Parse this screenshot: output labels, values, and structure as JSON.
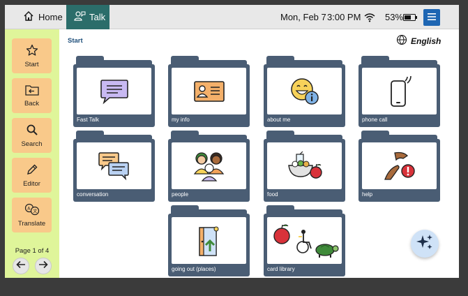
{
  "tabs": {
    "home": "Home",
    "talk": "Talk"
  },
  "status": {
    "date": "Mon, Feb 7",
    "time": "3:00 PM",
    "battery": "53%"
  },
  "sidebar": {
    "buttons": [
      {
        "label": "Start",
        "icon": "star-icon"
      },
      {
        "label": "Back",
        "icon": "back-folder-icon"
      },
      {
        "label": "Search",
        "icon": "search-icon"
      },
      {
        "label": "Editor",
        "icon": "pencil-icon"
      },
      {
        "label": "Translate",
        "icon": "translate-icon"
      }
    ],
    "page_indicator": "Page 1 of 4"
  },
  "breadcrumb": "Start",
  "language": "English",
  "folders": [
    {
      "label": "Fast Talk",
      "icon": "speech-bubble-icon"
    },
    {
      "label": "my info",
      "icon": "id-card-icon"
    },
    {
      "label": "about me",
      "icon": "smiley-info-icon"
    },
    {
      "label": "phone call",
      "icon": "phone-icon"
    },
    {
      "label": "conversation",
      "icon": "conversation-icon"
    },
    {
      "label": "people",
      "icon": "people-icon"
    },
    {
      "label": "food",
      "icon": "food-icon"
    },
    {
      "label": "help",
      "icon": "help-hands-icon"
    },
    {
      "label": "going out (places)",
      "icon": "door-exit-icon"
    },
    {
      "label": "card library",
      "icon": "card-library-icon"
    }
  ],
  "colors": {
    "talk_tab": "#2b6d6a",
    "sidebar": "#dff59a",
    "sidebar_button": "#f9c98a",
    "folder": "#4a5d74",
    "menu_button": "#1e66b3"
  }
}
